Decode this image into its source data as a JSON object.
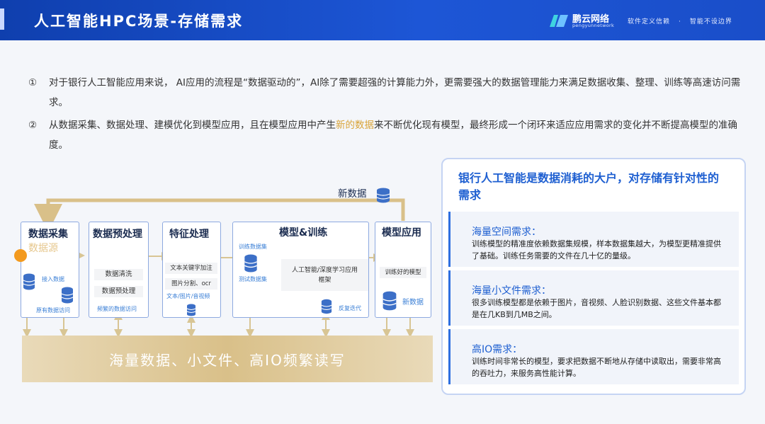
{
  "header": {
    "title": "人工智能HPC场景-存储需求",
    "logo_name": "鹏云网络",
    "logo_sub": "pengyunnetwork",
    "slogan_1": "软件定义信赖",
    "slogan_sep": "·",
    "slogan_2": "智能不设边界"
  },
  "intro": [
    {
      "num": "①",
      "text": "对于银行人工智能应用来说， AI应用的流程是“数据驱动的”，AI除了需要超强的计算能力外，更需要强大的数据管理能力来满足数据收集、整理、训练等高速访问需求。"
    },
    {
      "num": "②",
      "pre": "从数据采集、数据处理、建模优化到模型应用，且在模型应用中产生",
      "highlight": "新的数据",
      "post": "来不断优化现有模型，最终形成一个闭环来适应应用需求的变化并不断提高模型的准确度。"
    }
  ],
  "diagram": {
    "loop_label": "新数据",
    "stages": [
      {
        "title": "数据采集",
        "subtitle": "数据源",
        "notes": [
          "接入数据",
          "原有数据访问"
        ]
      },
      {
        "title": "数据预处理",
        "tags": [
          "数据清洗",
          "数据预处理"
        ],
        "note": "频繁的数据访问"
      },
      {
        "title": "特征处理",
        "tags": [
          "文本关键字加注",
          "图片分割、ocr"
        ],
        "note": "文本/图片/音视频"
      },
      {
        "title": "模型&训练",
        "notes": [
          "训练数据集",
          "测试数据集",
          "反复迭代"
        ],
        "tag": "人工智能/深度学习应用框架"
      },
      {
        "title": "模型应用",
        "tag": "训练好的模型",
        "note": "新数据"
      }
    ],
    "storage_bar": "海量数据、小文件、高IO频繁读写"
  },
  "panel": {
    "heading": "银行人工智能是数据消耗的大户，对存储有针对性的需求",
    "cards": [
      {
        "title": "海量空间需求：",
        "body": "训练模型的精准度依赖数据集规模，样本数据集越大，为模型更精准提供了基础。训练任务需要的文件在几十亿的量级。"
      },
      {
        "title": "海量小文件需求：",
        "body": "很多训练模型都是依赖于图片，音视频、人脸识别数据、这些文件基本都是在几KB到几MB之间。"
      },
      {
        "title": "高IO需求：",
        "body": "训练时间非常长的模型，要求把数据不断地从存储中读取出，需要非常高的吞吐力，来服务高性能计算。"
      }
    ]
  },
  "colors": {
    "brand_blue": "#1d56d6",
    "accent_gold": "#d9a43a",
    "storage_gold": "#d9c089",
    "orange_dot": "#f39a1e"
  }
}
